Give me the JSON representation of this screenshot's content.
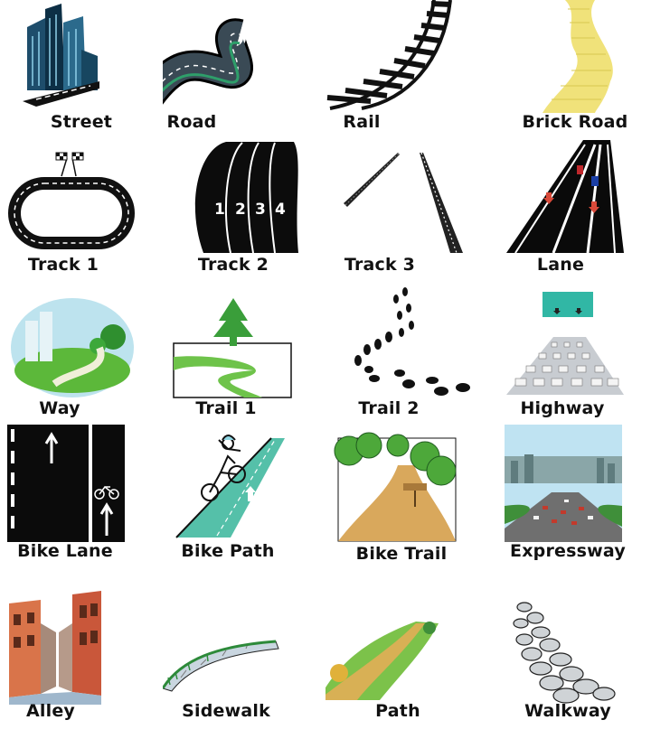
{
  "items": [
    {
      "label": "Street",
      "icon": "street-buildings-icon"
    },
    {
      "label": "Road",
      "icon": "winding-road-icon"
    },
    {
      "label": "Rail",
      "icon": "railway-track-icon"
    },
    {
      "label": "Brick Road",
      "icon": "yellow-brick-road-icon"
    },
    {
      "label": "Track 1",
      "icon": "race-track-icon"
    },
    {
      "label": "Track 2",
      "icon": "running-track-icon"
    },
    {
      "label": "Track 3",
      "icon": "tire-tracks-icon"
    },
    {
      "label": "Lane",
      "icon": "road-lanes-icon"
    },
    {
      "label": "Way",
      "icon": "green-way-icon"
    },
    {
      "label": "Trail 1",
      "icon": "forest-trail-icon"
    },
    {
      "label": "Trail 2",
      "icon": "footprints-trail-icon"
    },
    {
      "label": "Highway",
      "icon": "highway-traffic-icon"
    },
    {
      "label": "Bike Lane",
      "icon": "bike-lane-icon"
    },
    {
      "label": "Bike Path",
      "icon": "bike-path-icon"
    },
    {
      "label": "Bike Trail",
      "icon": "bike-trail-icon"
    },
    {
      "label": "Expressway",
      "icon": "expressway-icon"
    },
    {
      "label": "Alley",
      "icon": "alley-icon"
    },
    {
      "label": "Sidewalk",
      "icon": "sidewalk-icon"
    },
    {
      "label": "Path",
      "icon": "dirt-path-icon"
    },
    {
      "label": "Walkway",
      "icon": "stone-walkway-icon"
    }
  ],
  "track2_numbers": [
    "1",
    "2",
    "3",
    "4"
  ]
}
